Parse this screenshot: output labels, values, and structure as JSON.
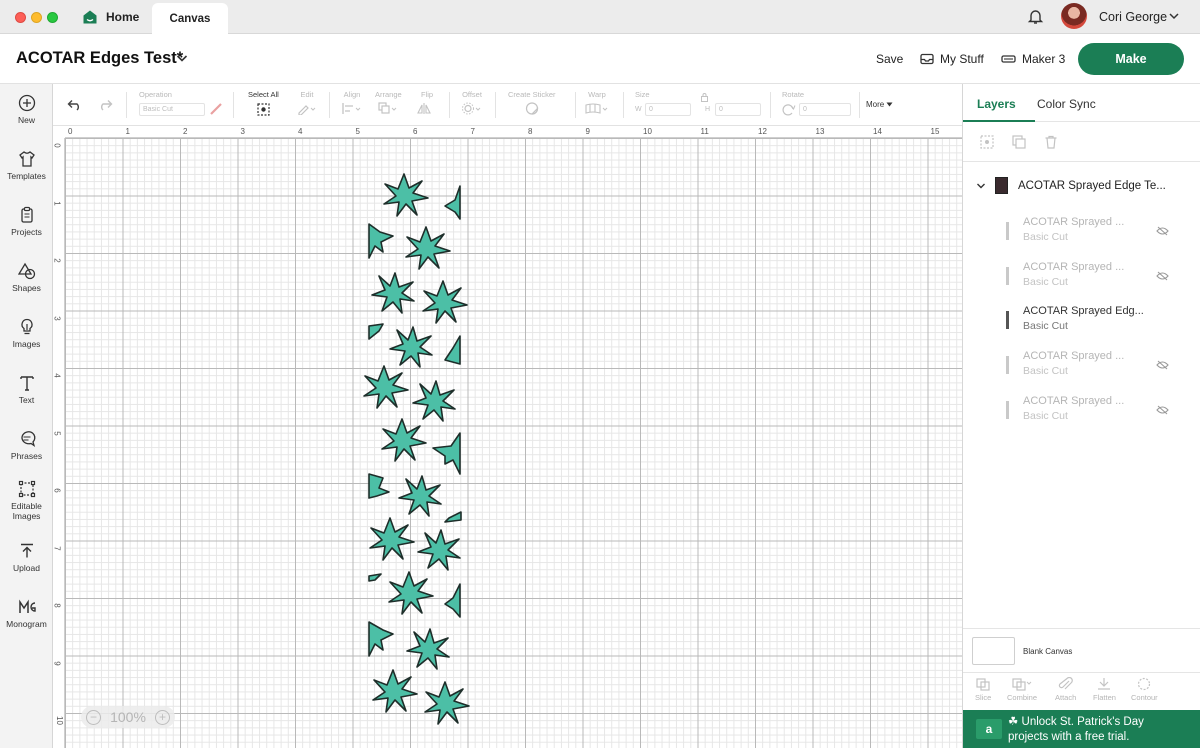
{
  "titlebar": {
    "tab_home": "Home",
    "tab_canvas": "Canvas",
    "user_name": "Cori George"
  },
  "header": {
    "project_title": "ACOTAR Edges Test*",
    "save_label": "Save",
    "my_stuff_label": "My Stuff",
    "machine_label": "Maker 3",
    "make_label": "Make"
  },
  "sidebar": {
    "items": [
      {
        "label": "New",
        "icon": "plus-circle-icon"
      },
      {
        "label": "Templates",
        "icon": "shirt-icon"
      },
      {
        "label": "Projects",
        "icon": "clipboard-icon"
      },
      {
        "label": "Shapes",
        "icon": "shapes-icon"
      },
      {
        "label": "Images",
        "icon": "lightbulb-icon"
      },
      {
        "label": "Text",
        "icon": "text-icon"
      },
      {
        "label": "Phrases",
        "icon": "speech-bubble-icon"
      },
      {
        "label": "Editable Images",
        "icon": "editable-images-icon"
      },
      {
        "label": "Upload",
        "icon": "upload-icon"
      },
      {
        "label": "Monogram",
        "icon": "monogram-icon"
      }
    ]
  },
  "toolbar": {
    "operation_label": "Operation",
    "operation_value": "Basic Cut",
    "select_all_label": "Select All",
    "edit_label": "Edit",
    "align_label": "Align",
    "arrange_label": "Arrange",
    "flip_label": "Flip",
    "offset_label": "Offset",
    "create_sticker_label": "Create Sticker",
    "warp_label": "Warp",
    "size_label": "Size",
    "size_w_label": "W",
    "size_w_value": "0",
    "size_h_label": "H",
    "size_h_value": "0",
    "rotate_label": "Rotate",
    "rotate_value": "0",
    "more_label": "More"
  },
  "canvas": {
    "ruler_top": [
      "0",
      "1",
      "2",
      "3",
      "4",
      "5",
      "6",
      "7",
      "8",
      "9",
      "10",
      "11",
      "12",
      "13",
      "14",
      "15"
    ],
    "ruler_left": [
      "0",
      "1",
      "2",
      "3",
      "4",
      "5",
      "6",
      "7",
      "8",
      "9",
      "10"
    ],
    "zoom_value": "100%",
    "design_color": "#4cbfa6"
  },
  "layers_panel": {
    "tab_layers": "Layers",
    "tab_color_sync": "Color Sync",
    "group_name": "ACOTAR Sprayed Edge Te...",
    "layers": [
      {
        "name": "ACOTAR Sprayed ...",
        "type": "Basic Cut",
        "visible": false
      },
      {
        "name": "ACOTAR Sprayed ...",
        "type": "Basic Cut",
        "visible": false
      },
      {
        "name": "ACOTAR Sprayed Edg...",
        "type": "Basic Cut",
        "visible": true
      },
      {
        "name": "ACOTAR Sprayed ...",
        "type": "Basic Cut",
        "visible": false
      },
      {
        "name": "ACOTAR Sprayed ...",
        "type": "Basic Cut",
        "visible": false
      }
    ],
    "blank_canvas_label": "Blank Canvas",
    "actions": [
      "Slice",
      "Combine",
      "Attach",
      "Flatten",
      "Contour"
    ],
    "promo_text_line1": "Unlock St. Patrick's Day",
    "promo_text_line2": "projects with a free trial.",
    "promo_logo": "a",
    "accent_color": "#1b7e55"
  }
}
